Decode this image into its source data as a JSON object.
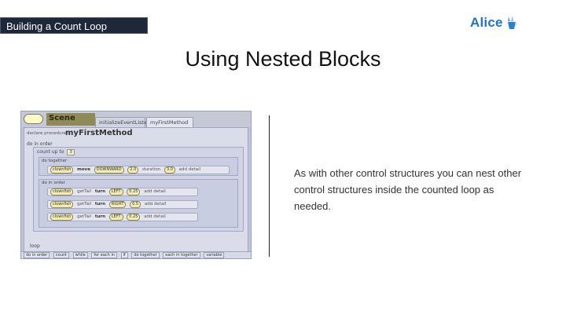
{
  "header": {
    "section_label": "Building a Count Loop"
  },
  "logo": {
    "text": "Alice",
    "icon": "bunny-icon",
    "color": "#1f74c9"
  },
  "slide": {
    "title": "Using Nested Blocks",
    "body": "As with other control structures you can nest other control structures inside the counted loop as needed."
  },
  "editor": {
    "scene_label": "Scene",
    "tabs": [
      "initializeEventListeners",
      "myFirstMethod"
    ],
    "declare_label": "declare procedure",
    "method_name": "myFirstMethod",
    "do_in_order": "do in order",
    "count_up_to": "count up to",
    "count_value": "3",
    "do_together": "do together",
    "move_stmt": {
      "object": "clownfish",
      "verb": "move",
      "direction": "DOWNWARD",
      "amount": "2.0",
      "duration_label": "duration",
      "duration": "3.0",
      "add_detail": "add detail"
    },
    "inner_do_in_order": "do in order",
    "turn_stmts": [
      {
        "object": "clownfish",
        "getter": "getTail",
        "verb": "turn",
        "direction": "LEFT",
        "amount": "0.25",
        "add_detail": "add detail"
      },
      {
        "object": "clownfish",
        "getter": "getTail",
        "verb": "turn",
        "direction": "RIGHT",
        "amount": "0.5",
        "add_detail": "add detail"
      },
      {
        "object": "clownfish",
        "getter": "getTail",
        "verb": "turn",
        "direction": "LEFT",
        "amount": "0.25",
        "add_detail": "add detail"
      }
    ],
    "loop_label": "loop",
    "footer_tiles": [
      "do in order",
      "count",
      "while",
      "for each in",
      "if",
      "do together",
      "each in together",
      "variable"
    ]
  }
}
